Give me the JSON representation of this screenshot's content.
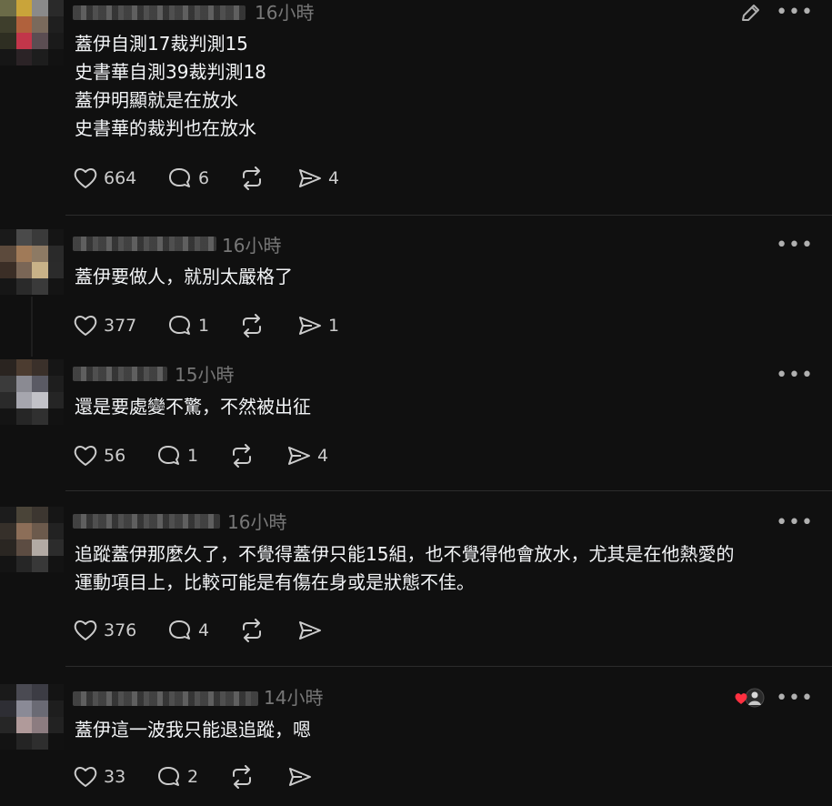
{
  "posts": [
    {
      "time": "16小時",
      "lines": [
        "蓋伊自測17裁判測15",
        "史書華自測39裁判測18",
        "蓋伊明顯就是在放水",
        "史書華的裁判也在放水"
      ],
      "likes": "664",
      "replies": "6",
      "reposts": "",
      "shares": "4",
      "editable": true
    },
    {
      "time": "16小時",
      "lines": [
        "蓋伊要做人，就別太嚴格了"
      ],
      "likes": "377",
      "replies": "1",
      "reposts": "",
      "shares": "1"
    },
    {
      "time": "15小時",
      "lines": [
        "還是要處變不驚，不然被出征"
      ],
      "likes": "56",
      "replies": "1",
      "reposts": "",
      "shares": "4"
    },
    {
      "time": "16小時",
      "lines": [
        "追蹤蓋伊那麼久了，不覺得蓋伊只能15組，也不覺得他會放水，尤其是在他熱愛的",
        "運動項目上，比較可能是有傷在身或是狀態不佳。"
      ],
      "likes": "376",
      "replies": "4",
      "reposts": "",
      "shares": ""
    },
    {
      "time": "14小時",
      "lines": [
        "蓋伊這一波我只能退追蹤，嗯"
      ],
      "likes": "33",
      "replies": "2",
      "reposts": "",
      "shares": "",
      "liked_by_author": true
    }
  ],
  "icons": {
    "more": "more-horizontal-icon",
    "edit": "pencil-icon",
    "like": "heart-icon",
    "reply": "speech-bubble-icon",
    "repost": "repost-arrows-icon",
    "share": "send-paper-plane-icon"
  },
  "colors": {
    "background": "#101010",
    "text": "#f3f5f7",
    "muted": "#777777",
    "divider": "#2c2c2c",
    "heart": "#ff3040"
  },
  "more_label": "•••"
}
